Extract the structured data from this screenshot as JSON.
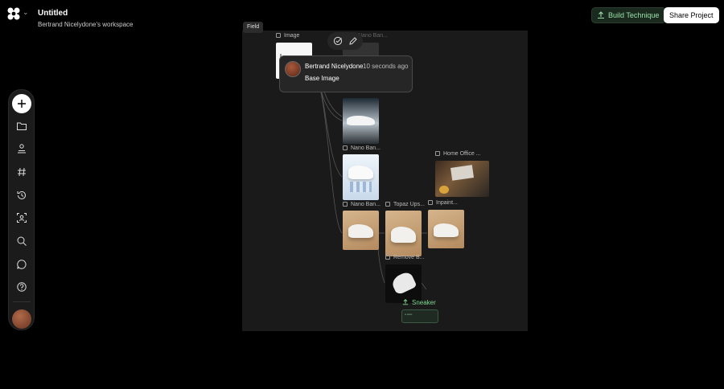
{
  "header": {
    "title": "Untitled",
    "workspace": "Bertrand Nicelydone's workspace",
    "build_label": "Build Technique",
    "share_label": "Share Project"
  },
  "canvas": {
    "field_tag": "Field",
    "nodes": {
      "image": "Image",
      "nano_top": "Nano Ban...",
      "nano_mid1": "Nano Ban...",
      "nano_mid2": "Nano Ban...",
      "nano_low": "Nano Ban...",
      "topaz": "Topaz Ups...",
      "inpaint": "Inpaint...",
      "home_office": "Home Office ...",
      "remove": "Remove B..."
    },
    "sneaker": "Sneaker"
  },
  "tooltip": {
    "user": "Bertrand Nicelydone",
    "time": "10 seconds ago",
    "body": "Base Image"
  },
  "colors": {
    "accent_green": "#7fd98f",
    "build_bg": "#1b2a1f"
  },
  "icons": [
    "logo-icon",
    "chevron-down-icon",
    "plus-icon",
    "folder-icon",
    "user-stack-icon",
    "hash-icon",
    "history-icon",
    "scan-face-icon",
    "search-icon",
    "chat-icon",
    "help-icon",
    "check-edit-icon",
    "pencil-icon",
    "upload-icon"
  ]
}
